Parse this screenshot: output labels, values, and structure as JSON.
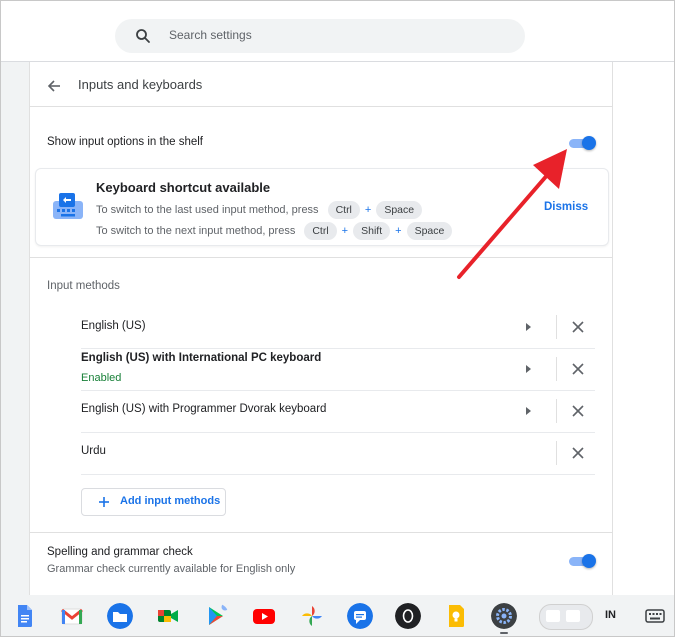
{
  "search": {
    "placeholder": "Search settings"
  },
  "header": {
    "title": "Inputs and keyboards"
  },
  "shelf_toggle": {
    "label": "Show input options in the shelf",
    "on": true
  },
  "shortcut_card": {
    "title": "Keyboard shortcut available",
    "line1_text": "To switch to the last used input method, press",
    "line1_keys": [
      "Ctrl",
      "Space"
    ],
    "line2_text": "To switch to the next input method, press",
    "line2_keys": [
      "Ctrl",
      "Shift",
      "Space"
    ],
    "plus": "+",
    "dismiss_label": "Dismiss"
  },
  "input_methods": {
    "section_label": "Input methods",
    "items": [
      {
        "name": "English (US)",
        "status": "",
        "has_settings": true
      },
      {
        "name": "English (US) with International PC keyboard",
        "status": "Enabled",
        "has_settings": true
      },
      {
        "name": "English (US) with Programmer Dvorak keyboard",
        "status": "",
        "has_settings": true
      },
      {
        "name": "Urdu",
        "status": "",
        "has_settings": false
      }
    ],
    "add_label": "Add input methods"
  },
  "spelling": {
    "title": "Spelling and grammar check",
    "subtitle": "Grammar check currently available for English only",
    "on": true
  },
  "shelf": {
    "apps": [
      "docs-icon",
      "gmail-icon",
      "files-icon",
      "meet-icon",
      "play-store-icon",
      "youtube-icon",
      "photos-icon",
      "messages-icon",
      "circle-o-icon",
      "keep-icon",
      "settings-icon"
    ],
    "ime_label": "IN"
  },
  "colors": {
    "accent": "#1a73e8",
    "enabled": "#188038",
    "annotation_arrow": "#e8222a"
  }
}
